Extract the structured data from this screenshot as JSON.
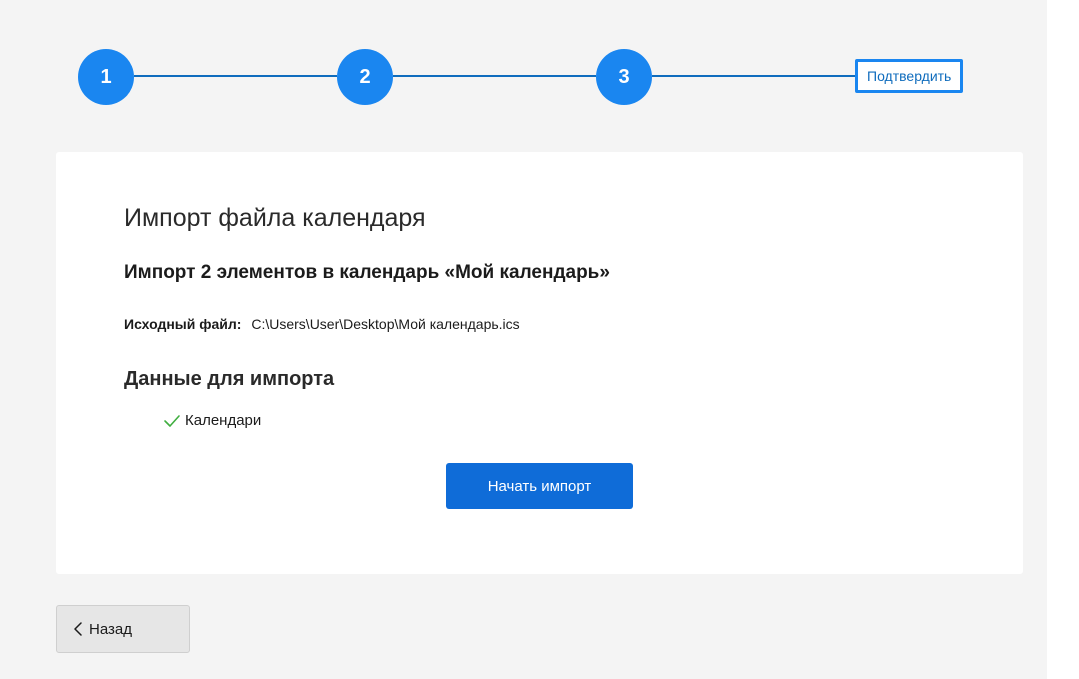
{
  "stepper": {
    "steps": [
      {
        "number": "1"
      },
      {
        "number": "2"
      },
      {
        "number": "3"
      }
    ],
    "final_label": "Подтвердить",
    "accent_color": "#1a86f0"
  },
  "card": {
    "title": "Импорт файла календаря",
    "subtitle": "Импорт 2 элементов в календарь «Мой календарь»",
    "source_label": "Исходный файл:",
    "source_value": "C:\\Users\\User\\Desktop\\Мой календарь.ics",
    "section_title": "Данные для импорта",
    "items": [
      {
        "label": "Календари",
        "icon": "check-icon",
        "checked": true
      }
    ],
    "start_button_label": "Начать импорт"
  },
  "footer": {
    "back_icon": "chevron-left-icon",
    "back_label": "Назад"
  }
}
